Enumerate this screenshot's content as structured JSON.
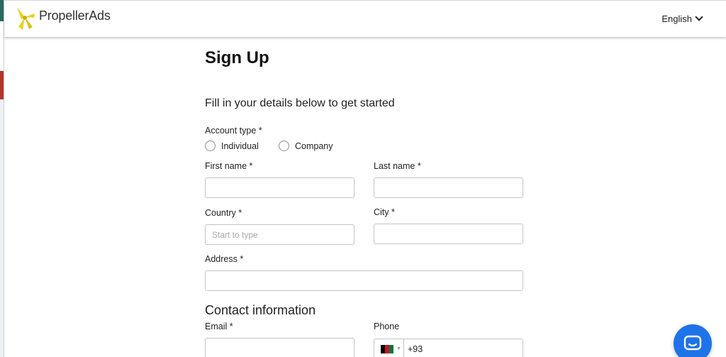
{
  "app": {
    "brand": "PropellerAds",
    "language": "English"
  },
  "form": {
    "title": "Sign Up",
    "subtitle": "Fill in your details below to get started",
    "account_type_label": "Account type  *",
    "account_options": [
      "Individual",
      "Company"
    ],
    "first_name_label": "First name  *",
    "last_name_label": "Last name  *",
    "country_label": "Country *",
    "country_placeholder": "Start to type",
    "city_label": "City  *",
    "address_label": "Address  *",
    "contact_section": "Contact information",
    "email_label": "Email  *",
    "phone_label": "Phone",
    "phone_code": "+93",
    "phone_country_flag": "afghanistan-flag",
    "first_name_value": "",
    "last_name_value": "",
    "city_value": "",
    "address_value": "",
    "email_value": ""
  },
  "colors": {
    "brand_yellow": "#e8d21d",
    "chat_blue": "#1f73e8"
  },
  "icons": {
    "language_chevron": "chevron-down-icon",
    "chat": "chat-icon",
    "logo": "propellerads-logo-icon"
  }
}
